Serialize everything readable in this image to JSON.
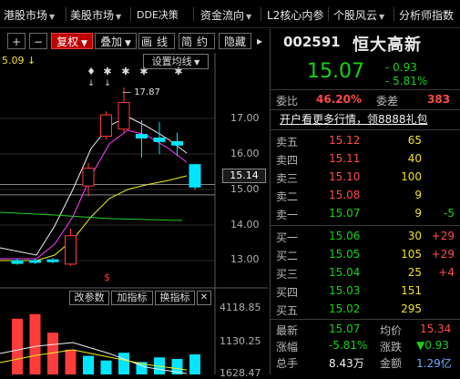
{
  "menu": [
    {
      "label": "港股市场",
      "caret": true
    },
    {
      "label": "美股市场",
      "caret": true
    },
    {
      "label": "DDE决策",
      "caret": false
    },
    {
      "label": "资金流向",
      "caret": true
    },
    {
      "label": "L2核心内参",
      "caret": false
    },
    {
      "label": "个股风云",
      "caret": true
    },
    {
      "label": "分析师指数",
      "caret": false
    }
  ],
  "toolbar": {
    "plus": "+",
    "minus": "−",
    "restore": "复权",
    "overlay": "叠加",
    "draw": "画线",
    "brief": "简约",
    "hide": "隐藏",
    "arrow": "▸",
    "settings": "设置均线",
    "top_left_price": "5.09"
  },
  "chart": {
    "price_labels": [
      "17.00",
      "16.00",
      "15.00",
      "14.00",
      "13.00"
    ],
    "current_price_tag": "15.14",
    "high_label": "17.87",
    "volume_labels": [
      "4118.85",
      "1130.25",
      "1628.47"
    ],
    "indicator_buttons": [
      "改参数",
      "加指标",
      "换指标"
    ],
    "close_glyph": "✕",
    "marker_symbol": "$",
    "colors": {
      "up": "#ff3c3c",
      "down": "#00e5ff",
      "ma5": "#f0f0f0",
      "ma10": "#ff40ff",
      "ma20": "#f0f020",
      "ma60": "#26d026"
    }
  },
  "quote": {
    "code": "002591",
    "name": "恒大高新",
    "price": "15.07",
    "change": "- 0.93",
    "change_pct": "- 5.81%"
  },
  "committee": {
    "ratio_label": "委比",
    "ratio": "46.20%",
    "diff_label": "委差",
    "diff": "383"
  },
  "promo": "开户看更多行情，领8888礼包",
  "asks": [
    {
      "label": "卖五",
      "price": "15.12",
      "vol": "65",
      "chg": ""
    },
    {
      "label": "卖四",
      "price": "15.11",
      "vol": "40",
      "chg": ""
    },
    {
      "label": "卖三",
      "price": "15.10",
      "vol": "100",
      "chg": ""
    },
    {
      "label": "卖二",
      "price": "15.08",
      "vol": "9",
      "chg": ""
    },
    {
      "label": "卖一",
      "price": "15.07",
      "vol": "9",
      "chg": "-5"
    }
  ],
  "bids": [
    {
      "label": "买一",
      "price": "15.06",
      "vol": "30",
      "chg": "+29"
    },
    {
      "label": "买二",
      "price": "15.05",
      "vol": "105",
      "chg": "+29"
    },
    {
      "label": "买三",
      "price": "15.04",
      "vol": "25",
      "chg": "+4"
    },
    {
      "label": "买四",
      "price": "15.03",
      "vol": "151",
      "chg": ""
    },
    {
      "label": "买五",
      "price": "15.02",
      "vol": "295",
      "chg": ""
    }
  ],
  "stats": [
    {
      "l1": "最新",
      "v1": "15.07",
      "l2": "均价",
      "v2": "15.34"
    },
    {
      "l1": "涨幅",
      "v1": "-5.81%",
      "l2": "涨跌",
      "v2": "▼0.93"
    },
    {
      "l1": "总手",
      "v1": "8.43万",
      "l2": "金额",
      "v2": "1.29亿"
    }
  ],
  "candles": [
    {
      "o": 13.0,
      "c": 12.92,
      "h": 13.05,
      "l": 12.88
    },
    {
      "o": 13.0,
      "c": 12.95,
      "h": 13.05,
      "l": 12.9
    },
    {
      "o": 13.02,
      "c": 12.97,
      "h": 13.07,
      "l": 12.92
    },
    {
      "o": 12.9,
      "c": 13.7,
      "h": 13.9,
      "l": 12.85
    },
    {
      "o": 15.1,
      "c": 15.6,
      "h": 15.75,
      "l": 14.8
    },
    {
      "o": 16.5,
      "c": 17.1,
      "h": 17.2,
      "l": 16.4
    },
    {
      "o": 16.7,
      "c": 17.45,
      "h": 17.87,
      "l": 16.6
    },
    {
      "o": 16.55,
      "c": 16.45,
      "h": 16.95,
      "l": 15.9
    },
    {
      "o": 16.45,
      "c": 16.35,
      "h": 16.9,
      "l": 16.0
    },
    {
      "o": 16.35,
      "c": 16.25,
      "h": 16.6,
      "l": 15.95
    },
    {
      "o": 15.7,
      "c": 15.07,
      "h": 15.72,
      "l": 15.0
    }
  ],
  "volumes": [
    {
      "v": 3600,
      "up": true
    },
    {
      "v": 3900,
      "up": true
    },
    {
      "v": 2700,
      "up": true
    },
    {
      "v": 1600,
      "up": true
    },
    {
      "v": 1200,
      "up": false
    },
    {
      "v": 900,
      "up": false
    },
    {
      "v": 1400,
      "up": false
    },
    {
      "v": 800,
      "up": false
    },
    {
      "v": 1100,
      "up": false
    },
    {
      "v": 1000,
      "up": false
    },
    {
      "v": 1300,
      "up": false
    }
  ]
}
